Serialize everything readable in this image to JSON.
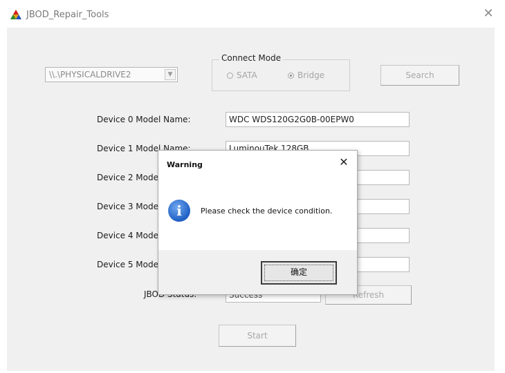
{
  "window": {
    "title": "JBOD_Repair_Tools",
    "close_glyph": "✕"
  },
  "drive_select": {
    "value": "\\\\.\\PHYSICALDRIVE2",
    "arrow": "▼"
  },
  "connect_mode": {
    "label": "Connect Mode",
    "options": [
      {
        "label": "SATA",
        "selected": false
      },
      {
        "label": "Bridge",
        "selected": true
      }
    ]
  },
  "search_button": "Search",
  "devices": [
    {
      "label": "Device 0 Model Name:",
      "value": "WDC WDS120G2G0B-00EPW0"
    },
    {
      "label": "Device 1 Model Name:",
      "value": "LuminouTek 128GB"
    },
    {
      "label": "Device 2 Model Name:",
      "value": ""
    },
    {
      "label": "Device 3 Model Name:",
      "value": ""
    },
    {
      "label": "Device 4 Model Name:",
      "value": ""
    },
    {
      "label": "Device 5 Model Name:",
      "value": ""
    }
  ],
  "status": {
    "label": "JBOD Status:",
    "value": "Success"
  },
  "refresh_button": "Refresh",
  "start_button": "Start",
  "dialog": {
    "title": "Warning",
    "close_glyph": "✕",
    "icon": "info-icon",
    "message": "Please check the device condition.",
    "ok_label": "确定"
  }
}
